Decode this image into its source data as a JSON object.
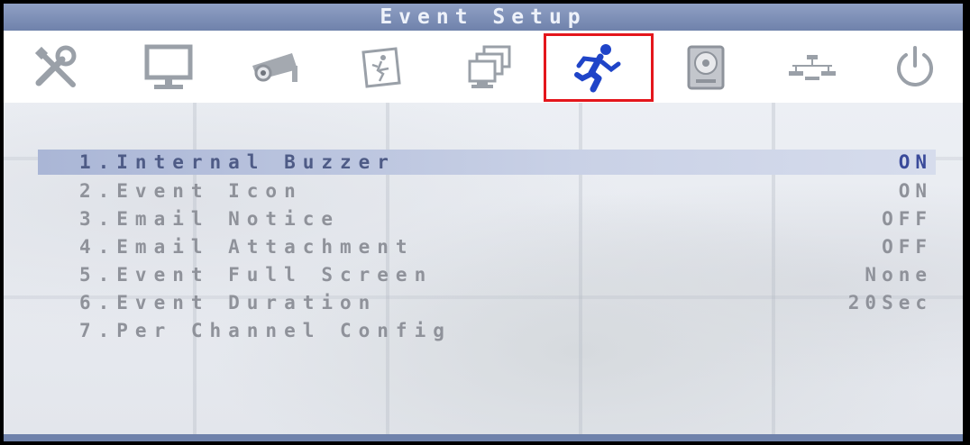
{
  "title": "Event  Setup",
  "toolbar": {
    "icons": [
      {
        "name": "tools-icon",
        "selected": false
      },
      {
        "name": "monitor-icon",
        "selected": false
      },
      {
        "name": "camera-icon",
        "selected": false
      },
      {
        "name": "motion-sign-icon",
        "selected": false
      },
      {
        "name": "multi-screen-icon",
        "selected": false
      },
      {
        "name": "running-man-icon",
        "selected": true
      },
      {
        "name": "hard-disk-icon",
        "selected": false
      },
      {
        "name": "network-icon",
        "selected": false
      },
      {
        "name": "power-icon",
        "selected": false
      }
    ],
    "selected_color": "#e4161c"
  },
  "menu": {
    "items": [
      {
        "label": "1.Internal Buzzer",
        "value": "ON",
        "selected": true
      },
      {
        "label": "2.Event Icon",
        "value": "ON",
        "selected": false
      },
      {
        "label": "3.Email Notice",
        "value": "OFF",
        "selected": false
      },
      {
        "label": "4.Email Attachment",
        "value": "OFF",
        "selected": false
      },
      {
        "label": "5.Event Full Screen",
        "value": "None",
        "selected": false
      },
      {
        "label": "6.Event Duration",
        "value": "20Sec",
        "selected": false
      },
      {
        "label": "7.Per Channel Config",
        "value": "",
        "selected": false
      }
    ]
  }
}
